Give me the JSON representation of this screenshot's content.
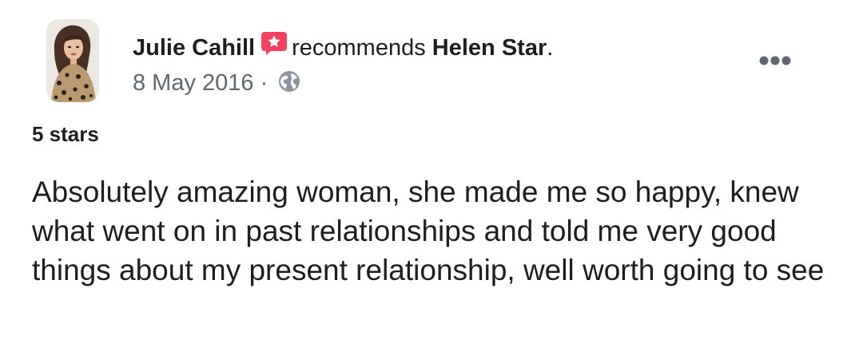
{
  "post": {
    "author": "Julie Cahill",
    "action": "recommends",
    "page": "Helen Star",
    "page_suffix": ".",
    "date": "8 May 2016",
    "separator": "·",
    "privacy_icon": "globe-icon",
    "recommend_icon": "recommend-badge-icon",
    "more_icon": "more-options-icon",
    "rating_label": "5 stars",
    "text": "Absolutely amazing woman, she made me so happy, knew what went on in past relationships and told me very good things about my present relationship, well worth going to see"
  },
  "colors": {
    "text": "#1c1e21",
    "meta": "#616770",
    "recommend_badge": "#f3425f"
  }
}
